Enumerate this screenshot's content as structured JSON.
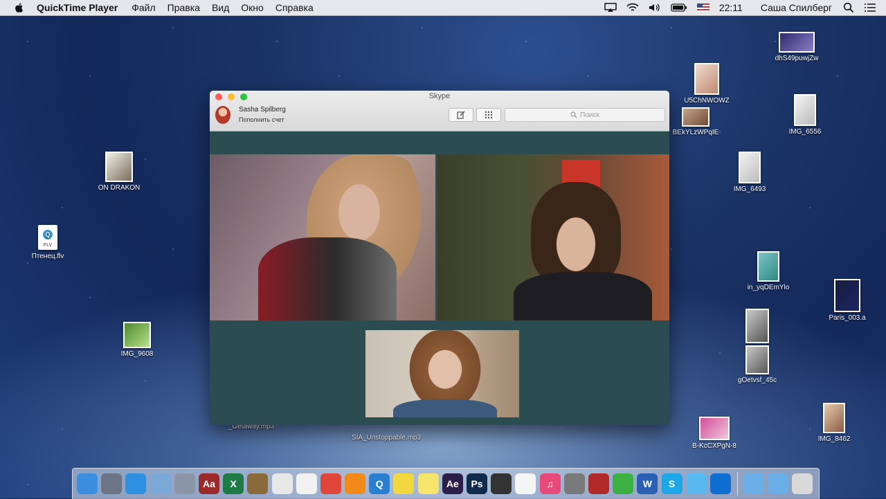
{
  "menubar": {
    "app_name": "QuickTime Player",
    "menus": [
      "Файл",
      "Правка",
      "Вид",
      "Окно",
      "Справка"
    ],
    "clock": "22:11",
    "user": "Саша Спилберг",
    "status_icons": [
      "airplay-icon",
      "wifi-icon",
      "volume-icon",
      "battery-icon",
      "flag-us-icon",
      "search-icon",
      "list-icon"
    ]
  },
  "desktop_icons": [
    {
      "label": "dhS49puwjZw",
      "kind": "photo"
    },
    {
      "label": "U5ChNWOWZ",
      "kind": "photo"
    },
    {
      "label": "BEkYLzWPqIE",
      "kind": "photo"
    },
    {
      "label": "IMG_6556",
      "kind": "photo"
    },
    {
      "label": "IMG_6493",
      "kind": "photo"
    },
    {
      "label": "ON DRAKON",
      "kind": "photo"
    },
    {
      "label": "Птенец.flv",
      "kind": "video"
    },
    {
      "label": "in_yqDEmYlo",
      "kind": "photo"
    },
    {
      "label": "Paris_003.a",
      "kind": "photo"
    },
    {
      "label": "IMG_9608",
      "kind": "photo"
    },
    {
      "label": "gOetvsf_45c",
      "kind": "photo"
    },
    {
      "label": "IMG_8462",
      "kind": "photo"
    },
    {
      "label": "B-KcCXPgN-8",
      "kind": "photo"
    },
    {
      "label": "_Getaway.mp3",
      "kind": "audio"
    },
    {
      "label": "SIA_Unstoppable.mp3",
      "kind": "audio"
    }
  ],
  "skype": {
    "title": "Skype",
    "user_name": "Sasha Spilberg",
    "credit_link": "Пополнить счет",
    "search_placeholder": "Поиск"
  },
  "dock": {
    "items": [
      {
        "name": "finder",
        "color": "#3c8ee0",
        "glyph": ""
      },
      {
        "name": "launchpad",
        "color": "#6d7486",
        "glyph": ""
      },
      {
        "name": "safari",
        "color": "#2f8fe0",
        "glyph": ""
      },
      {
        "name": "preview",
        "color": "#7aa9d8",
        "glyph": ""
      },
      {
        "name": "image-capture",
        "color": "#8a96a6",
        "glyph": ""
      },
      {
        "name": "dictionary",
        "color": "#9c2a2a",
        "glyph": "Aa"
      },
      {
        "name": "excel",
        "color": "#1e7b45",
        "glyph": "X"
      },
      {
        "name": "notebook",
        "color": "#8a6a3a",
        "glyph": ""
      },
      {
        "name": "textedit",
        "color": "#e8e8e8",
        "glyph": ""
      },
      {
        "name": "pages",
        "color": "#f2f2f2",
        "glyph": ""
      },
      {
        "name": "chrome",
        "color": "#e0463a",
        "glyph": ""
      },
      {
        "name": "vlc",
        "color": "#f28a1a",
        "glyph": ""
      },
      {
        "name": "quicktime",
        "color": "#2a7fd0",
        "glyph": "Q"
      },
      {
        "name": "stickies",
        "color": "#f2d840",
        "glyph": ""
      },
      {
        "name": "notes",
        "color": "#f5e56b",
        "glyph": ""
      },
      {
        "name": "after-effects",
        "color": "#2b1f4a",
        "glyph": "Ae"
      },
      {
        "name": "photoshop",
        "color": "#0f2a4a",
        "glyph": "Ps"
      },
      {
        "name": "final-cut",
        "color": "#333333",
        "glyph": ""
      },
      {
        "name": "photos",
        "color": "#f5f5f5",
        "glyph": ""
      },
      {
        "name": "itunes",
        "color": "#e84b7a",
        "glyph": "♫"
      },
      {
        "name": "system-preferences",
        "color": "#7a7a7a",
        "glyph": ""
      },
      {
        "name": "photo-booth",
        "color": "#b02a2a",
        "glyph": ""
      },
      {
        "name": "facetime",
        "color": "#3cb043",
        "glyph": ""
      },
      {
        "name": "word",
        "color": "#2b5fb4",
        "glyph": "W"
      },
      {
        "name": "skype",
        "color": "#1ea7e8",
        "glyph": "S"
      },
      {
        "name": "messages",
        "color": "#5ab8f0",
        "glyph": ""
      },
      {
        "name": "teamviewer",
        "color": "#0f6ed2",
        "glyph": ""
      }
    ],
    "stacks": [
      {
        "name": "applications-folder",
        "color": "#6aaee8"
      },
      {
        "name": "downloads-folder",
        "color": "#6aaee8"
      },
      {
        "name": "trash",
        "color": "#d9d9d9"
      }
    ]
  }
}
